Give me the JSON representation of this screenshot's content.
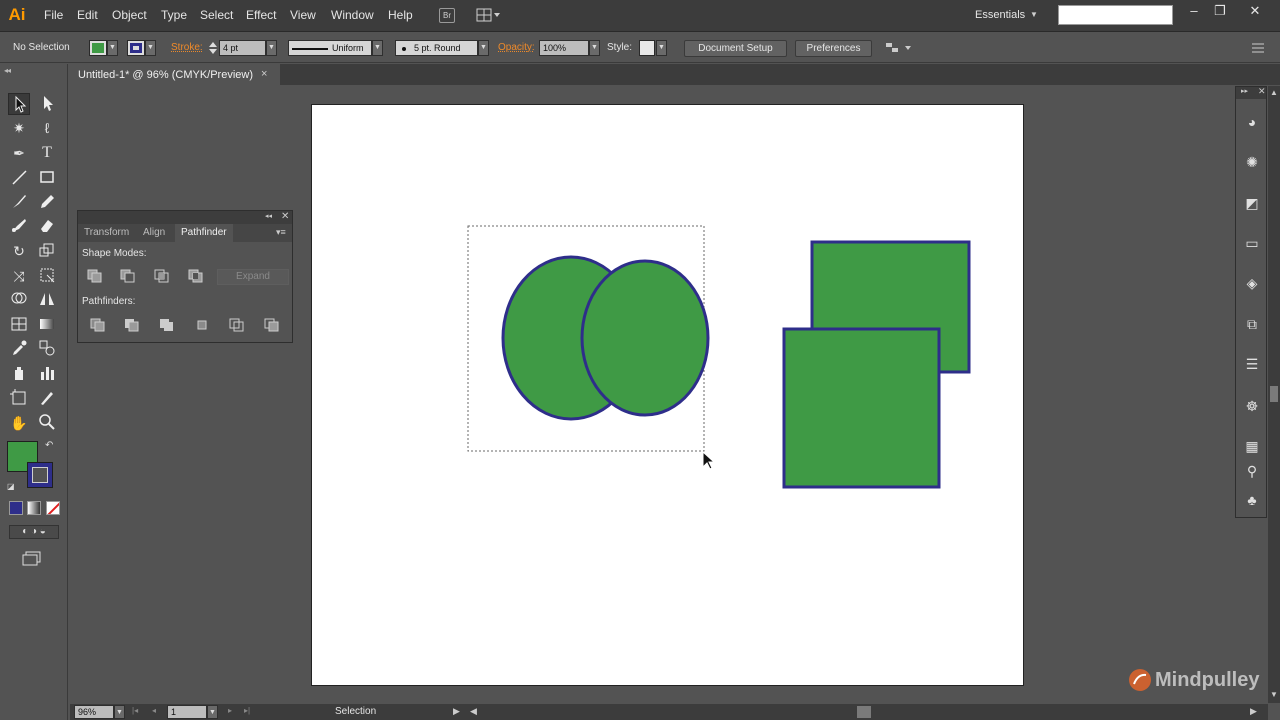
{
  "app": {
    "logo_text": "Ai"
  },
  "menubar": {
    "items": [
      "File",
      "Edit",
      "Object",
      "Type",
      "Select",
      "Effect",
      "View",
      "Window",
      "Help"
    ],
    "bridge_label": "Br",
    "workspace": "Essentials",
    "search_value": "",
    "window_buttons": [
      "–",
      "❐",
      "✕"
    ]
  },
  "controlbar": {
    "selection_label": "No Selection",
    "fill_color": "#3f9a45",
    "stroke_color": "#2e2e8a",
    "stroke_label": "Stroke:",
    "stroke_weight": "4 pt",
    "profile": "Uniform",
    "brush": "5 pt. Round",
    "opacity_label": "Opacity:",
    "opacity_value": "100%",
    "style_label": "Style:",
    "document_setup_label": "Document Setup",
    "preferences_label": "Preferences"
  },
  "document": {
    "tab_title": "Untitled-1* @ 96% (CMYK/Preview)",
    "close_glyph": "×"
  },
  "toolbar": {
    "tools": [
      "selection-tool",
      "direct-selection-tool",
      "magic-wand-tool",
      "lasso-tool",
      "pen-tool",
      "type-tool",
      "line-segment-tool",
      "rectangle-tool",
      "paintbrush-tool",
      "pencil-tool",
      "blob-brush-tool",
      "eraser-tool",
      "rotate-tool",
      "scale-tool",
      "width-tool",
      "free-transform-tool",
      "shape-builder-tool",
      "perspective-grid-tool",
      "mesh-tool",
      "gradient-tool",
      "eyedropper-tool",
      "blend-tool",
      "symbol-sprayer-tool",
      "column-graph-tool",
      "artboard-tool",
      "slice-tool",
      "hand-tool",
      "zoom-tool"
    ]
  },
  "pathfinder_panel": {
    "tabs": [
      "Transform",
      "Align",
      "Pathfinder"
    ],
    "active_tab": "Pathfinder",
    "shape_modes_label": "Shape Modes:",
    "pathfinders_label": "Pathfinders:",
    "expand_label": "Expand"
  },
  "canvas": {
    "fill_color": "#3f9a45",
    "stroke_color": "#2e2e8a"
  },
  "statusbar": {
    "zoom": "96%",
    "artboard_number": "1",
    "status": "Selection"
  },
  "watermark": {
    "text": "Mindpulley"
  }
}
